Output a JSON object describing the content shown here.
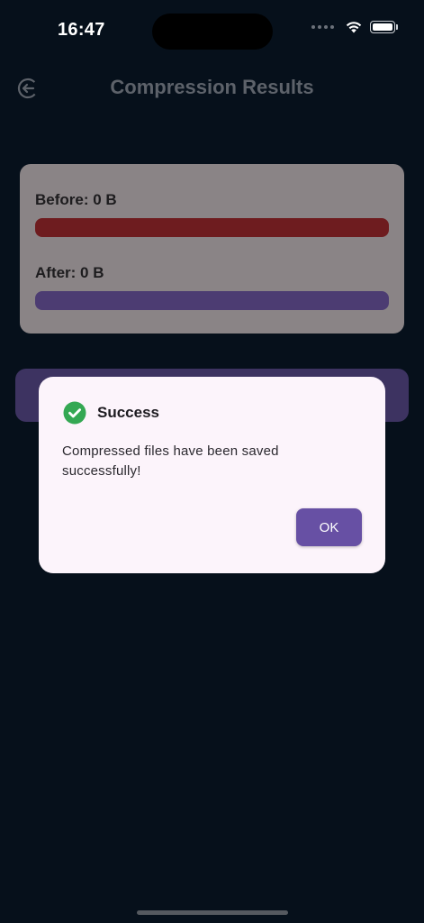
{
  "status_bar": {
    "time": "16:47"
  },
  "app_bar": {
    "title": "Compression Results",
    "back_icon": "logout-arrow-icon"
  },
  "results": {
    "before_label": "Before: 0 B",
    "after_label": "After: 0 B",
    "before_color": "#6e1c1f",
    "after_color": "#4c3c72"
  },
  "dialog": {
    "title": "Success",
    "icon": "check-circle-icon",
    "icon_color": "#34a853",
    "message": "Compressed files have been saved successfully!",
    "ok_label": "OK",
    "button_color": "#6750a4"
  }
}
